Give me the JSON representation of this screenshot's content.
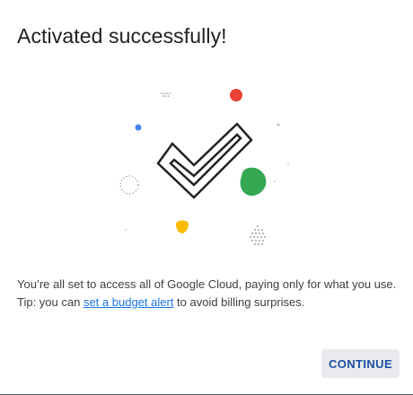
{
  "dialog": {
    "title": "Activated successfully!",
    "message_line1": "You’re all set to access all of Google Cloud, paying only for what you use.",
    "tip_prefix": "Tip: you can ",
    "tip_link": "set a budget alert",
    "tip_suffix": " to avoid billing surprises.",
    "continue_label": "CONTINUE"
  },
  "colors": {
    "title_text": "#202124",
    "body_text": "#3c4043",
    "link": "#1a73e8",
    "button_bg": "#e8eaed",
    "button_text": "#1a4fa3",
    "dot_red": "#ea4335",
    "dot_blue": "#4285f4",
    "dot_green": "#34a853",
    "dot_yellow": "#fbbc04"
  },
  "illustration": {
    "icon": "checkmark-icon"
  }
}
